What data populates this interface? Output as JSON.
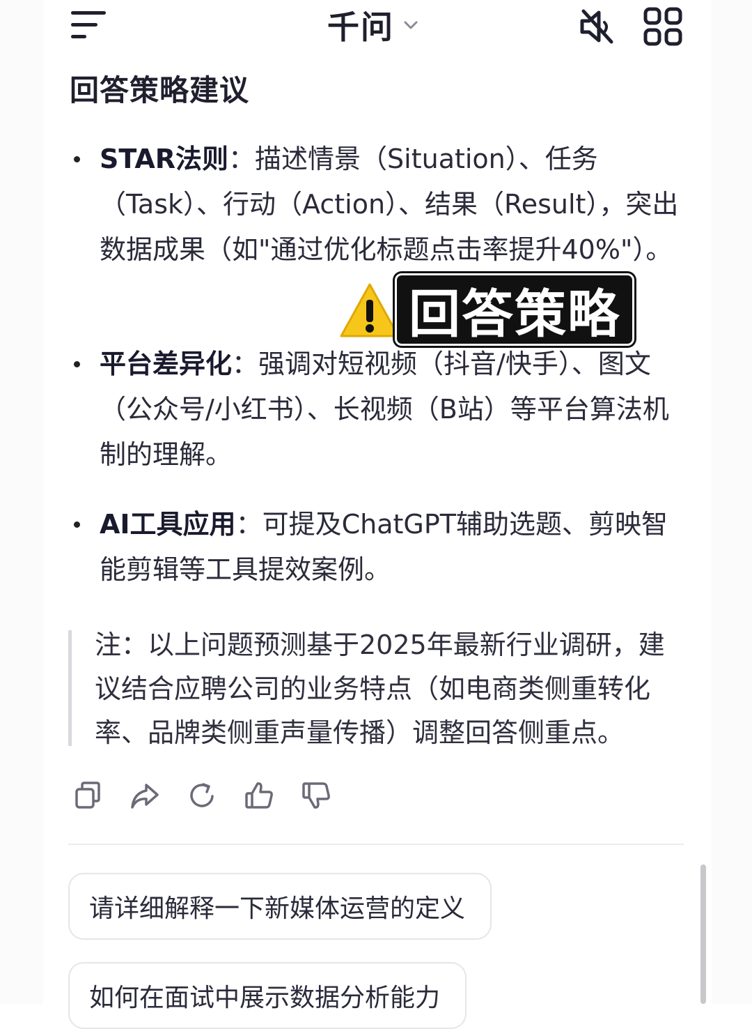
{
  "app": {
    "title": "千问",
    "icons": {
      "menu": "menu-icon",
      "title_dropdown": "chevron-down-icon",
      "mute": "speaker-muted-icon",
      "apps": "apps-grid-icon"
    }
  },
  "content": {
    "section_title": "回答策略建议",
    "bullets": [
      {
        "term": "STAR法则",
        "colon": "：",
        "text": "描述情景（Situation）、任务（Task）、行动（Action）、结果（Result），突出数据成果（如\"通过优化标题点击率提升40%\"）。"
      },
      {
        "term": "平台差异化",
        "colon": "：",
        "text": "强调对短视频（抖音/快手）、图文（公众号/小红书）、长视频（B站）等平台算法机制的理解。"
      },
      {
        "term": "AI工具应用",
        "colon": "：",
        "text": "可提及ChatGPT辅助选题、剪映智能剪辑等工具提效案例。"
      }
    ],
    "note": "注：以上问题预测基于2025年最新行业调研，建议结合应聘公司的业务特点（如电商类侧重转化率、品牌类侧重声量传播）调整回答侧重点。"
  },
  "overlay": {
    "sticker_text": "回答策略",
    "warning_icon": "warning-icon"
  },
  "actions": [
    "copy-icon",
    "share-icon",
    "refresh-icon",
    "thumbs-up-icon",
    "thumbs-down-icon"
  ],
  "suggestions": [
    "请详细解释一下新媒体运营的定义",
    "如何在面试中展示数据分析能力"
  ],
  "colors": {
    "text": "#1a1a2e",
    "warning": "#f7c61b",
    "divider": "#ececf0"
  }
}
